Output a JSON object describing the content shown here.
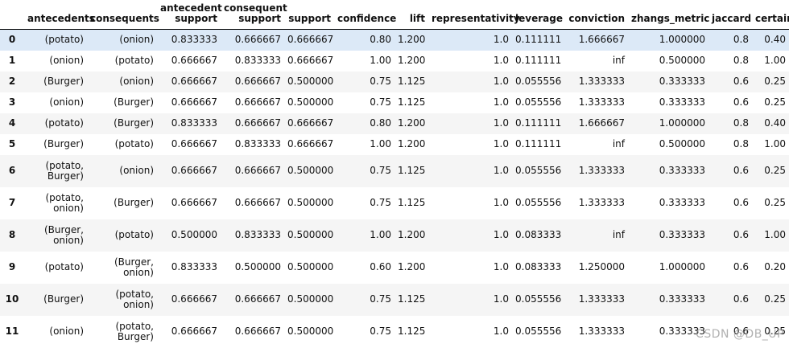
{
  "table": {
    "columns": [
      "antecedents",
      "consequents",
      "antecedent support",
      "consequent support",
      "support",
      "confidence",
      "lift",
      "representativity",
      "leverage",
      "conviction",
      "zhangs_metric",
      "jaccard",
      "certainty"
    ],
    "rows": [
      {
        "index": "0",
        "cells": [
          "(potato)",
          "(onion)",
          "0.833333",
          "0.666667",
          "0.666667",
          "0.80",
          "1.200",
          "1.0",
          "0.111111",
          "1.666667",
          "1.000000",
          "0.8",
          "0.40"
        ]
      },
      {
        "index": "1",
        "cells": [
          "(onion)",
          "(potato)",
          "0.666667",
          "0.833333",
          "0.666667",
          "1.00",
          "1.200",
          "1.0",
          "0.111111",
          "inf",
          "0.500000",
          "0.8",
          "1.00"
        ]
      },
      {
        "index": "2",
        "cells": [
          "(Burger)",
          "(onion)",
          "0.666667",
          "0.666667",
          "0.500000",
          "0.75",
          "1.125",
          "1.0",
          "0.055556",
          "1.333333",
          "0.333333",
          "0.6",
          "0.25"
        ]
      },
      {
        "index": "3",
        "cells": [
          "(onion)",
          "(Burger)",
          "0.666667",
          "0.666667",
          "0.500000",
          "0.75",
          "1.125",
          "1.0",
          "0.055556",
          "1.333333",
          "0.333333",
          "0.6",
          "0.25"
        ]
      },
      {
        "index": "4",
        "cells": [
          "(potato)",
          "(Burger)",
          "0.833333",
          "0.666667",
          "0.666667",
          "0.80",
          "1.200",
          "1.0",
          "0.111111",
          "1.666667",
          "1.000000",
          "0.8",
          "0.40"
        ]
      },
      {
        "index": "5",
        "cells": [
          "(Burger)",
          "(potato)",
          "0.666667",
          "0.833333",
          "0.666667",
          "1.00",
          "1.200",
          "1.0",
          "0.111111",
          "inf",
          "0.500000",
          "0.8",
          "1.00"
        ]
      },
      {
        "index": "6",
        "cells": [
          "(potato, Burger)",
          "(onion)",
          "0.666667",
          "0.666667",
          "0.500000",
          "0.75",
          "1.125",
          "1.0",
          "0.055556",
          "1.333333",
          "0.333333",
          "0.6",
          "0.25"
        ]
      },
      {
        "index": "7",
        "cells": [
          "(potato, onion)",
          "(Burger)",
          "0.666667",
          "0.666667",
          "0.500000",
          "0.75",
          "1.125",
          "1.0",
          "0.055556",
          "1.333333",
          "0.333333",
          "0.6",
          "0.25"
        ]
      },
      {
        "index": "8",
        "cells": [
          "(Burger, onion)",
          "(potato)",
          "0.500000",
          "0.833333",
          "0.500000",
          "1.00",
          "1.200",
          "1.0",
          "0.083333",
          "inf",
          "0.333333",
          "0.6",
          "1.00"
        ]
      },
      {
        "index": "9",
        "cells": [
          "(potato)",
          "(Burger, onion)",
          "0.833333",
          "0.500000",
          "0.500000",
          "0.60",
          "1.200",
          "1.0",
          "0.083333",
          "1.250000",
          "1.000000",
          "0.6",
          "0.20"
        ]
      },
      {
        "index": "10",
        "cells": [
          "(Burger)",
          "(potato, onion)",
          "0.666667",
          "0.666667",
          "0.500000",
          "0.75",
          "1.125",
          "1.0",
          "0.055556",
          "1.333333",
          "0.333333",
          "0.6",
          "0.25"
        ]
      },
      {
        "index": "11",
        "cells": [
          "(onion)",
          "(potato, Burger)",
          "0.666667",
          "0.666667",
          "0.500000",
          "0.75",
          "1.125",
          "1.0",
          "0.055556",
          "1.333333",
          "0.333333",
          "0.6",
          "0.25"
        ]
      }
    ]
  },
  "watermark": "CSDN @DB_UP",
  "colors": {
    "hover_row": "#dce9f7",
    "striped_row": "#f5f5f5",
    "header_rule": "#000000"
  }
}
